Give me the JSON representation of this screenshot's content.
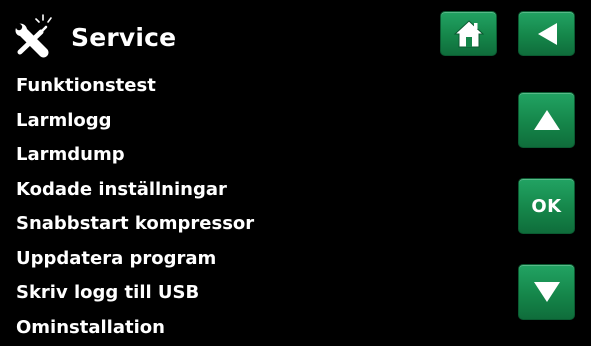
{
  "header": {
    "title": "Service",
    "icon": "tools-icon"
  },
  "nav": {
    "home_icon": "home-icon",
    "back_icon": "back-arrow-icon",
    "up_icon": "arrow-up-icon",
    "ok_label": "OK",
    "down_icon": "arrow-down-icon"
  },
  "menu": {
    "items": [
      {
        "label": "Funktionstest"
      },
      {
        "label": "Larmlogg"
      },
      {
        "label": "Larmdump"
      },
      {
        "label": "Kodade inställningar"
      },
      {
        "label": "Snabbstart kompressor"
      },
      {
        "label": "Uppdatera program"
      },
      {
        "label": "Skriv logg till USB"
      },
      {
        "label": "Ominstallation"
      }
    ]
  },
  "colors": {
    "background": "#000000",
    "text": "#ffffff",
    "button": "#15864a"
  }
}
